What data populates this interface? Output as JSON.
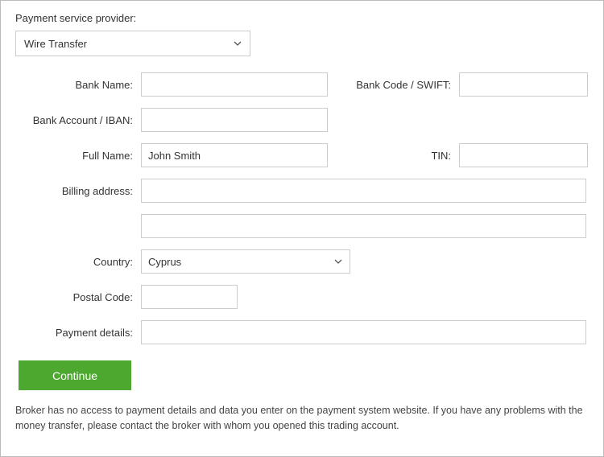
{
  "header": {
    "label": "Payment service provider:"
  },
  "provider_select": {
    "value": "Wire Transfer"
  },
  "fields": {
    "bank_name": {
      "label": "Bank Name:",
      "value": ""
    },
    "bank_code": {
      "label": "Bank Code / SWIFT:",
      "value": ""
    },
    "iban": {
      "label": "Bank Account / IBAN:",
      "value": ""
    },
    "full_name": {
      "label": "Full Name:",
      "value": "John Smith"
    },
    "tin": {
      "label": "TIN:",
      "value": ""
    },
    "billing_address": {
      "label": "Billing address:",
      "value1": "",
      "value2": ""
    },
    "country": {
      "label": "Country:",
      "value": "Cyprus"
    },
    "postal": {
      "label": "Postal Code:",
      "value": ""
    },
    "payment_details": {
      "label": "Payment details:",
      "value": ""
    }
  },
  "buttons": {
    "continue": "Continue"
  },
  "footer": {
    "text": "Broker has no access to payment details and data you enter on the payment system website. If you have any problems with the money transfer, please contact the broker with whom you opened this trading account."
  }
}
